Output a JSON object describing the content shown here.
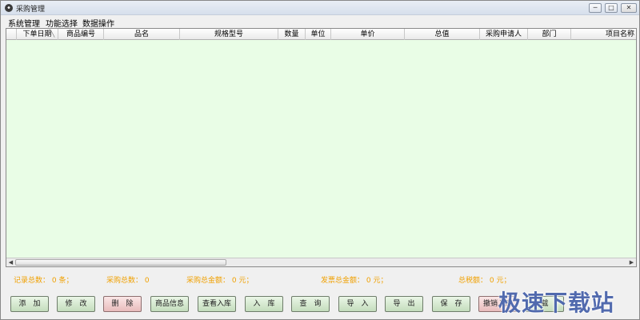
{
  "window": {
    "title": "采购管理",
    "controls": {
      "minimize": "─",
      "maximize": "□",
      "close": "✕"
    }
  },
  "menu": [
    "系统管理",
    "功能选择",
    "数据操作"
  ],
  "table": {
    "columns": [
      "下单日期",
      "商品编号",
      "品名",
      "规格型号",
      "数量",
      "单位",
      "单价",
      "总值",
      "采购申请人",
      "部门",
      "项目名称"
    ],
    "rows": [],
    "background": "#e9fde6"
  },
  "stats": {
    "record_count": "记录总数： 0 条；",
    "purchase_total": "采购总数： 0",
    "purchase_amount": "采购总金额： 0 元；",
    "invoice_amount": "发票总金额： 0 元；",
    "tax_total": "总税额： 0 元；",
    "color": "#f0a000"
  },
  "buttons": {
    "add": "添　加",
    "edit": "修　改",
    "delete": "删　除",
    "product_info": "商品信息",
    "view_stock_in": "查看入库",
    "stock_in": "入　库",
    "query": "查　询",
    "import": "导　入",
    "export": "导　出",
    "save": "保　存",
    "revoke_stock_in": "撤销入库",
    "load": "载"
  },
  "watermark": "极速下载站"
}
